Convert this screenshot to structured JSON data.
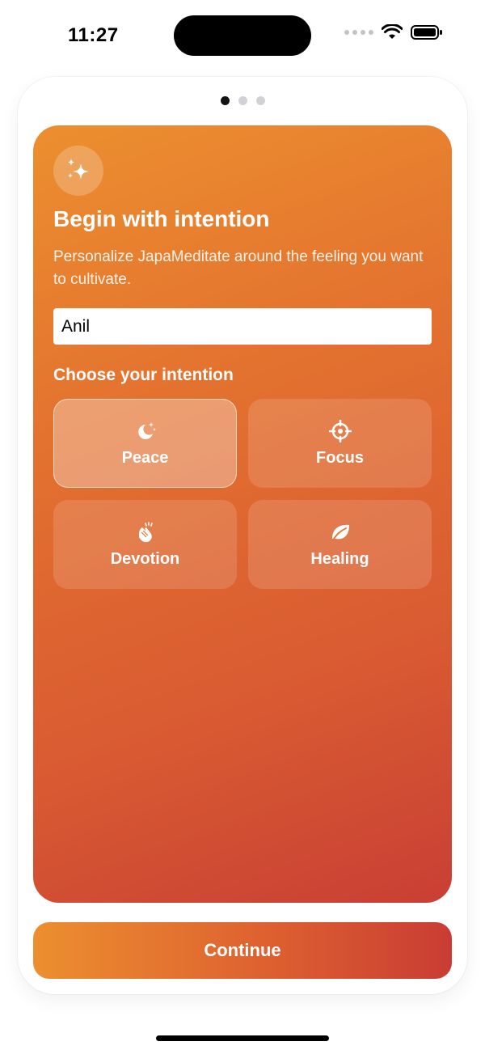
{
  "status_bar": {
    "time": "11:27"
  },
  "pager": {
    "total": 3,
    "active_index": 0
  },
  "hero": {
    "icon": "sparkles-icon",
    "title": "Begin with intention",
    "subtitle": "Personalize JapaMeditate around the feeling you want to cultivate.",
    "name_value": "Anil",
    "section_label": "Choose your intention"
  },
  "intentions": [
    {
      "label": "Peace",
      "icon": "moon-stars-icon",
      "selected": true
    },
    {
      "label": "Focus",
      "icon": "scope-icon",
      "selected": false
    },
    {
      "label": "Devotion",
      "icon": "hands-clap-icon",
      "selected": false
    },
    {
      "label": "Healing",
      "icon": "leaf-icon",
      "selected": false
    }
  ],
  "continue_label": "Continue",
  "colors": {
    "gradient_start": "#ec8f2f",
    "gradient_end": "#c93f34"
  }
}
